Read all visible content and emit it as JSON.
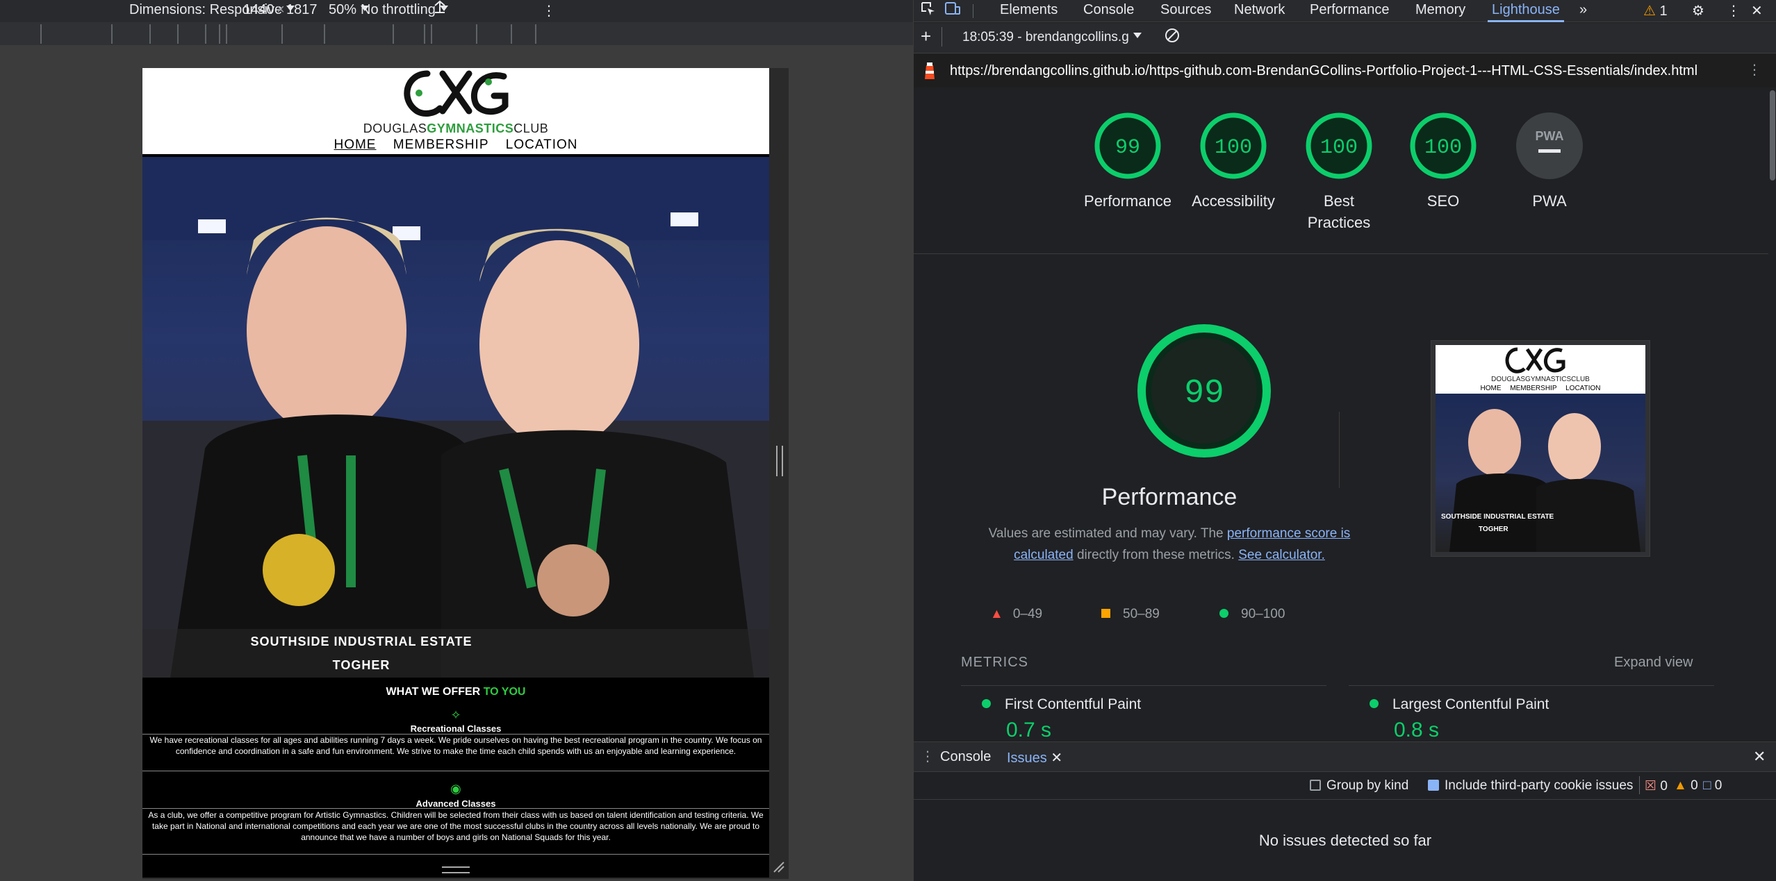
{
  "device_toolbar": {
    "dimensions_label": "Dimensions: Responsive",
    "width": "1440",
    "times": "×",
    "height": "1817",
    "zoom": "50%",
    "throttling": "No throttling",
    "more_label": "⋮"
  },
  "site": {
    "logo_text_left": "DOUGLAS",
    "logo_text_mid": "GYMNASTICS",
    "logo_text_right": "CLUB",
    "nav": [
      "HOME",
      "MEMBERSHIP",
      "LOCATION"
    ],
    "hero_caption_1": "SOUTHSIDE INDUSTRIAL ESTATE",
    "hero_caption_2": "TOGHER",
    "offer_title_a": "WHAT WE OFFER",
    "offer_title_b": "TO YOU",
    "recreational": {
      "title": "Recreational Classes",
      "text": "We have recreational classes for all ages and abilities running 7 days a week. We pride ourselves on having the best recreational program in the country. We focus on confidence and coordination in a safe and fun environment. We strive to make the time each child spends with us an enjoyable and learning experience."
    },
    "advanced": {
      "title": "Advanced Classes",
      "text": "As a club, we offer a competitive program for Artistic Gymnastics. Children will be selected from their class with us based on talent identification and testing criteria. We take part in National and international competitions and each year we are one of the most successful clubs in the country across all levels nationally. We are proud to announce that we have a number of boys and girls on National Squads for this year."
    }
  },
  "devtools": {
    "tabs": [
      "Elements",
      "Console",
      "Sources",
      "Network",
      "Performance",
      "Memory",
      "Lighthouse"
    ],
    "active_tab": "Lighthouse",
    "more_tabs": "»",
    "warning_count": "1",
    "report_selector": "18:05:39 - brendangcollins.g",
    "url": "https://brendangcollins.github.io/https-github.com-BrendanGCollins-Portfolio-Project-1---HTML-CSS-Essentials/index.html",
    "scores": [
      {
        "label": "Performance",
        "value": "99"
      },
      {
        "label": "Accessibility",
        "value": "100"
      },
      {
        "label": "Best Practices",
        "value": "100"
      },
      {
        "label": "SEO",
        "value": "100"
      },
      {
        "label": "PWA",
        "value": "—"
      }
    ],
    "pwa_badge": "PWA",
    "performance": {
      "score": "99",
      "title": "Performance",
      "desc_1": "Values are estimated and may vary. The ",
      "link_1": "performance score is calculated",
      "desc_2": " directly from these metrics. ",
      "link_2": "See calculator."
    },
    "legend": [
      {
        "range": "0–49",
        "color": "#ff4e42"
      },
      {
        "range": "50–89",
        "color": "#ffa400"
      },
      {
        "range": "90–100",
        "color": "#0cce6b"
      }
    ],
    "metrics_heading": "METRICS",
    "expand_view": "Expand view",
    "metrics": [
      {
        "name": "First Contentful Paint",
        "value": "0.7 s"
      },
      {
        "name": "Largest Contentful Paint",
        "value": "0.8 s"
      }
    ],
    "thumb": {
      "nav": [
        "HOME",
        "MEMBERSHIP",
        "LOCATION"
      ],
      "logo_text": "DOUGLASGYMNASTICSCLUB",
      "caption_1": "SOUTHSIDE INDUSTRIAL ESTATE",
      "caption_2": "TOGHER"
    },
    "drawer": {
      "tabs": [
        "Console",
        "Issues"
      ],
      "active": "Issues",
      "group_by_kind": "Group by kind",
      "include_third_party": "Include third-party cookie issues",
      "counts": [
        "0",
        "0",
        "0"
      ],
      "empty_message": "No issues detected so far"
    }
  },
  "colors": {
    "accent": "#8ab4f8",
    "pass": "#0cce6b",
    "club_green": "#2e9e3e"
  }
}
